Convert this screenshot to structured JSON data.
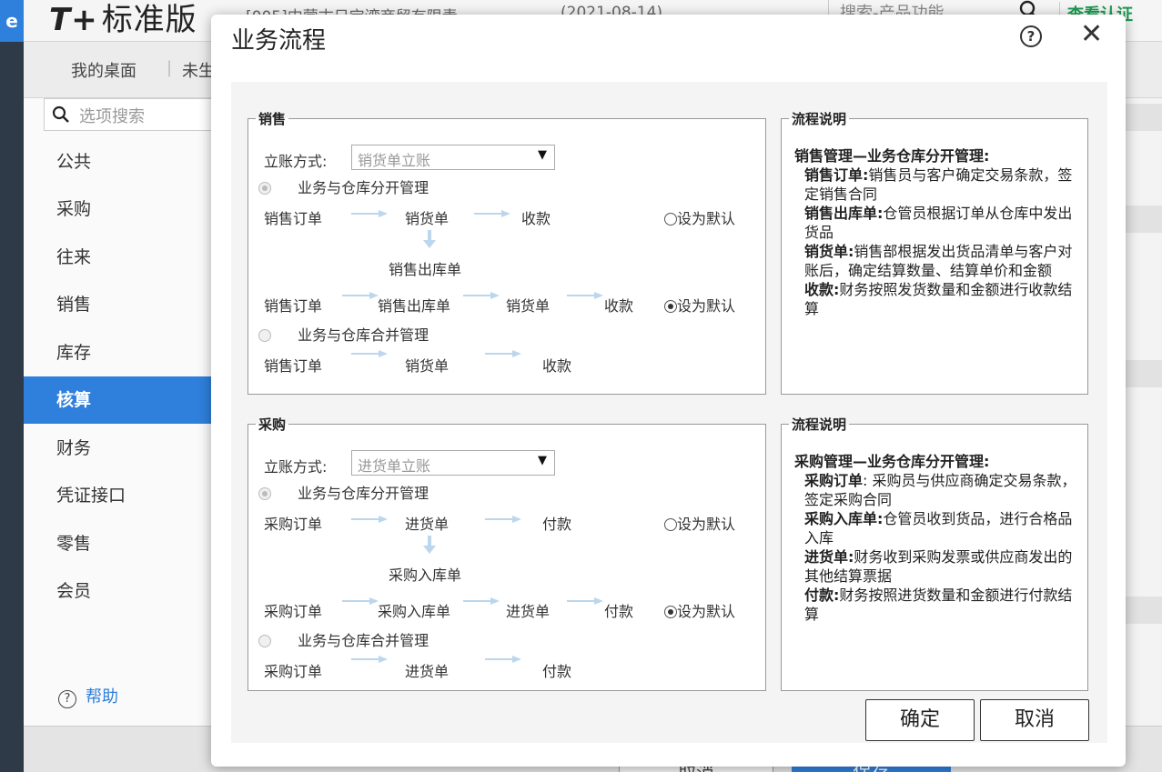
{
  "app": {
    "brand": "T+",
    "edition": "标准版",
    "company": "[005]内蒙古日宝湾商贸有限责",
    "date": "(2021-08-14)",
    "search_placeholder": "搜索-产品功能",
    "cert_link": "查看认证",
    "tabs": [
      "我的桌面",
      "未生"
    ],
    "nav_search_placeholder": "选项搜索",
    "nav_items": [
      "公共",
      "采购",
      "往来",
      "销售",
      "库存",
      "核算",
      "财务",
      "凭证接口",
      "零售",
      "会员"
    ],
    "active_nav": "核算",
    "help": "帮助",
    "footer_buttons": [
      "取消",
      "保存"
    ]
  },
  "dialog": {
    "title": "业务流程",
    "help_glyph": "?",
    "close_glyph": "✕",
    "sales": {
      "legend": "销售",
      "mode_label": "立账方式:",
      "mode_value": "销货单立账",
      "separate_mgmt": "业务与仓库分开管理",
      "merged_mgmt": "业务与仓库合并管理",
      "set_default": "设为默认",
      "flow1": [
        "销售订单",
        "销货单",
        "收款"
      ],
      "flow1_below": "销售出库单",
      "flow2": [
        "销售订单",
        "销售出库单",
        "销货单",
        "收款"
      ],
      "flow3": [
        "销售订单",
        "销货单",
        "收款"
      ]
    },
    "sales_desc": {
      "legend": "流程说明",
      "heading": "销售管理—业务仓库分开管理:",
      "items": [
        {
          "term": "销售订单:",
          "text": "销售员与客户确定交易条款，签定销售合同"
        },
        {
          "term": "销售出库单:",
          "text": "仓管员根据订单从仓库中发出货品"
        },
        {
          "term": "销货单:",
          "text": "销售部根据发出货品清单与客户对账后，确定结算数量、结算单价和金额"
        },
        {
          "term": "收款:",
          "text": "财务按照发货数量和金额进行收款结算"
        }
      ]
    },
    "purchase": {
      "legend": "采购",
      "mode_label": "立账方式:",
      "mode_value": "进货单立账",
      "separate_mgmt": "业务与仓库分开管理",
      "merged_mgmt": "业务与仓库合并管理",
      "set_default": "设为默认",
      "flow1": [
        "采购订单",
        "进货单",
        "付款"
      ],
      "flow1_below": "采购入库单",
      "flow2": [
        "采购订单",
        "采购入库单",
        "进货单",
        "付款"
      ],
      "flow3": [
        "采购订单",
        "进货单",
        "付款"
      ]
    },
    "purchase_desc": {
      "legend": "流程说明",
      "heading": "采购管理—业务仓库分开管理:",
      "items": [
        {
          "term": "采购订单",
          "text": ": 采购员与供应商确定交易条款，签定采购合同"
        },
        {
          "term": "采购入库单:",
          "text": "仓管员收到货品，进行合格品入库"
        },
        {
          "term": "进货单:",
          "text": "财务收到采购发票或供应商发出的其他结算票据"
        },
        {
          "term": "付款:",
          "text": "财务按照进货数量和金额进行付款结算"
        }
      ]
    },
    "ok": "确定",
    "cancel": "取消"
  }
}
